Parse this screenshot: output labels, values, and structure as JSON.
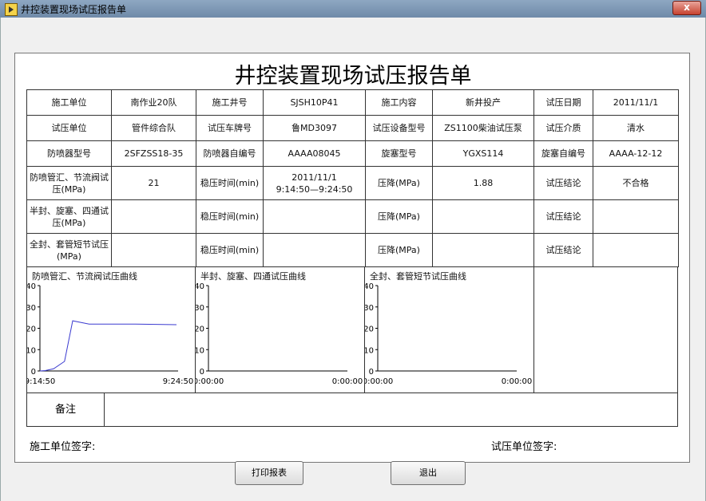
{
  "window": {
    "title": "井控装置现场试压报告单",
    "close_label": "x"
  },
  "report": {
    "title": "井控装置现场试压报告单",
    "rows": [
      [
        "施工单位",
        "南作业20队",
        "施工井号",
        "SJSH10P41",
        "施工内容",
        "新井投产",
        "试压日期",
        "2011/11/1"
      ],
      [
        "试压单位",
        "管件综合队",
        "试压车牌号",
        "鲁MD3097",
        "试压设备型号",
        "ZS1100柴油试压泵",
        "试压介质",
        "清水"
      ],
      [
        "防喷器型号",
        "2SFZSS18-35",
        "防喷器自编号",
        "AAAA08045",
        "旋塞型号",
        "YGXS114",
        "旋塞自编号",
        "AAAA-12-12"
      ]
    ],
    "test_rows": [
      {
        "item": "防喷管汇、节流阀试压(MPa)",
        "pressure": "21",
        "stab_label": "稳压时间(min)",
        "stab_line1": "2011/11/1",
        "stab_line2": "9:14:50—9:24:50",
        "drop_label": "压降(MPa)",
        "drop_value": "1.88",
        "result_label": "试压结论",
        "result_value": "不合格"
      },
      {
        "item": "半封、旋塞、四通试压(MPa)",
        "pressure": "",
        "stab_label": "稳压时间(min)",
        "stab_line1": "",
        "stab_line2": "",
        "drop_label": "压降(MPa)",
        "drop_value": "",
        "result_label": "试压结论",
        "result_value": ""
      },
      {
        "item": "全封、套管短节试压 (MPa)",
        "pressure": "",
        "stab_label": "稳压时间(min)",
        "stab_line1": "",
        "stab_line2": "",
        "drop_label": "压降(MPa)",
        "drop_value": "",
        "result_label": "试压结论",
        "result_value": ""
      }
    ],
    "notes_label": "备注",
    "construction_signature": "施工单位签字:",
    "test_signature": "试压单位签字:"
  },
  "chart_data": [
    {
      "type": "line",
      "title": "防喷管汇、节流阀试压曲线",
      "y_ticks": [
        "40",
        "30",
        "20",
        "10",
        "0"
      ],
      "ylim": [
        0,
        40
      ],
      "x_ticks": [
        "9:14:50",
        "9:24:50"
      ],
      "series": [
        {
          "color": "#3b3bd0",
          "x": [
            0,
            0.4,
            1.0,
            1.8,
            2.4,
            3.6,
            5.0,
            7.0,
            9.0,
            10.0
          ],
          "y": [
            0.0,
            0.2,
            1.0,
            4.5,
            23.5,
            22.0,
            22.0,
            22.0,
            21.8,
            21.7
          ]
        }
      ]
    },
    {
      "type": "line",
      "title": "半封、旋塞、四通试压曲线",
      "y_ticks": [
        "40",
        "30",
        "20",
        "10",
        "0"
      ],
      "ylim": [
        0,
        40
      ],
      "x_ticks": [
        "0:00:00",
        "0:00:00"
      ],
      "series": []
    },
    {
      "type": "line",
      "title": "全封、套管短节试压曲线",
      "y_ticks": [
        "40",
        "30",
        "20",
        "10",
        "0"
      ],
      "ylim": [
        0,
        40
      ],
      "x_ticks": [
        "0:00:00",
        "0:00:00"
      ],
      "series": []
    }
  ],
  "buttons": {
    "print": "打印报表",
    "exit": "退出"
  }
}
